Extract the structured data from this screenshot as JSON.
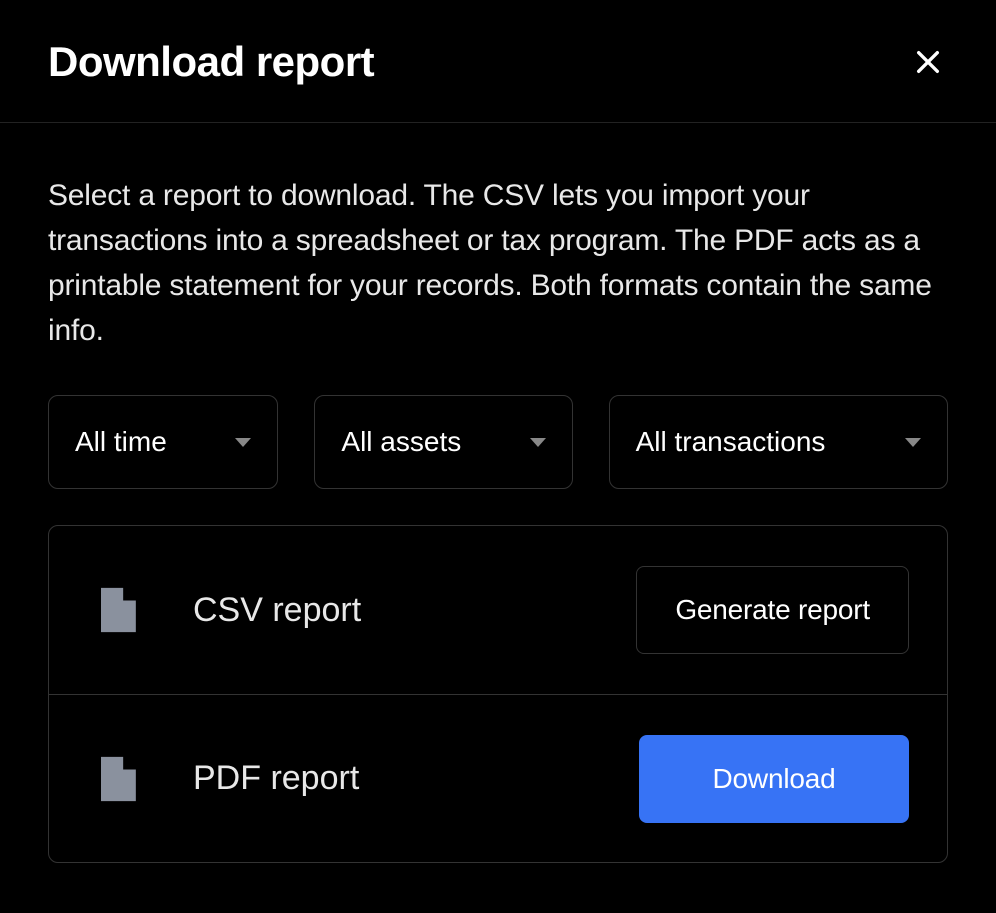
{
  "header": {
    "title": "Download report"
  },
  "description": "Select a report to download. The CSV lets you import your transactions into a spreadsheet or tax program. The PDF acts as a printable statement for your records. Both formats contain the same info.",
  "filters": {
    "time": "All time",
    "assets": "All assets",
    "transactions": "All transactions"
  },
  "reports": {
    "csv": {
      "label": "CSV report",
      "action": "Generate report"
    },
    "pdf": {
      "label": "PDF report",
      "action": "Download"
    }
  }
}
